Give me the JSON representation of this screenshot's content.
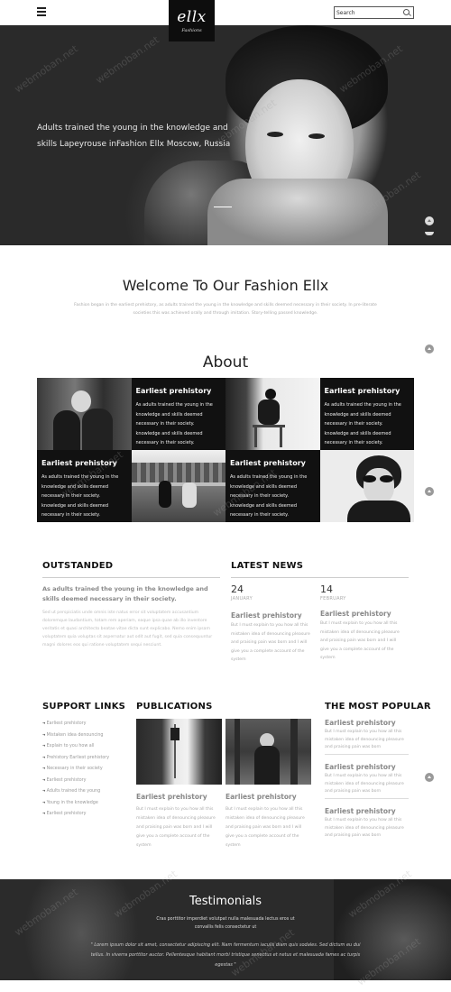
{
  "header": {
    "logo_main": "ellx",
    "logo_sub": "Fashions",
    "search_placeholder": "Search"
  },
  "hero": {
    "text": "Adults trained the young in the knowledge and skills Lapeyrouse inFashion Ellx Moscow, Russia"
  },
  "welcome": {
    "title": "Welcome To Our Fashion Ellx",
    "text": "Fashion began in the earliest prehistory, as adults trained the young in the knowledge and skills deemed necessary in their society. In pre-literate societies this was achieved orally and through imitation. Story-telling passed knowledge."
  },
  "about": {
    "title": "About",
    "tiles": [
      {
        "title": "Earliest prehistory",
        "body": "As adults trained the young in the knowledge and skills deemed necessary in their society. knowledge and skills deemed necessary in their society."
      },
      {
        "title": "Earliest prehistory",
        "body": "As adults trained the young in the knowledge and skills deemed necessary in their society. knowledge and skills deemed necessary in their society."
      },
      {
        "title": "Earliest prehistory",
        "body": "As adults trained the young in the knowledge and skills deemed necessary in their society. knowledge and skills deemed necessary in their society."
      },
      {
        "title": "Earliest prehistory",
        "body": "As adults trained the young in the knowledge and skills deemed necessary in their society. knowledge and skills deemed necessary in their society."
      }
    ]
  },
  "outstanded": {
    "title": "OUTSTANDED",
    "lead": "As adults trained the young in the knowledge and skills deemed necessary in their society.",
    "body": "Sed ut perspiciatis unde omnis iste natus error sit voluptatem accusantium doloremque laudantium, totam rem aperiam, eaque ipsa quae ab illo inventore veritatis et quasi architecto beatae vitae dicta sunt explicabo. Nemo enim ipsam voluptatem quia voluptas sit aspernatur aut odit aut fugit, sed quia consequuntur magni dolores eos qui ratione voluptatem sequi nesciunt."
  },
  "news": {
    "title": "LATEST NEWS",
    "items": [
      {
        "day": "24",
        "month": "JANUARY",
        "title": "Earliest prehistory",
        "body": "But I must explain to you how all this mistaken idea of denouncing pleasure and praising pain was born and I will give you a complete account of the system"
      },
      {
        "day": "14",
        "month": "FEBRUARY",
        "title": "Earliest prehistory",
        "body": "But I must explain to you how all this mistaken idea of denouncing pleasure and praising pain was born and I will give you a complete account of the system"
      }
    ]
  },
  "support": {
    "title": "SUPPORT LINKS",
    "links": [
      "Earliest prehistory",
      "Mistaken idea denouncing",
      "Explain to you how all",
      "Prehistory Earliest prehistory",
      "Necessary in their society",
      "Earliest prehistory",
      "Adults trained the young",
      "Young in the knowledge",
      "Earliest prehistory"
    ]
  },
  "publications": {
    "title": "PUBLICATIONS",
    "items": [
      {
        "title": "Earliest prehistory",
        "body": "But I must explain to you how all this mistaken idea of denouncing pleasure and praising pain was born and I will give you a complete account of the system"
      },
      {
        "title": "Earliest prehistory",
        "body": "But I must explain to you how all this mistaken idea of denouncing pleasure and praising pain was born and I will give you a complete account of the system"
      }
    ]
  },
  "popular": {
    "title": "THE MOST POPULAR",
    "items": [
      {
        "title": "Earliest prehistory",
        "body": "But I must explain to you how all this mistaken idea of denouncing pleasure and praising pain was born"
      },
      {
        "title": "Earliest prehistory",
        "body": "But I must explain to you how all this mistaken idea of denouncing pleasure and praising pain was born"
      },
      {
        "title": "Earliest prehistory",
        "body": "But I must explain to you how all this mistaken idea of denouncing pleasure and praising pain was born"
      }
    ]
  },
  "testimonials": {
    "title": "Testimonials",
    "sub": "Cras porttitor imperdiet volutpat nulla malesuada lectus eros ut convallis felis consectetur ut",
    "quote": "\" Lorem ipsum dolor sit amet, consectetur adipiscing elit. Nam fermentum iaculis diam quis sodales. Sed dictum eu dui tellus. In viverra porttitor auctor. Pellentesque habitant morbi tristique senectus et netus et malesuada fames ac turpis egestas \""
  },
  "watermark": "webmoban.net"
}
